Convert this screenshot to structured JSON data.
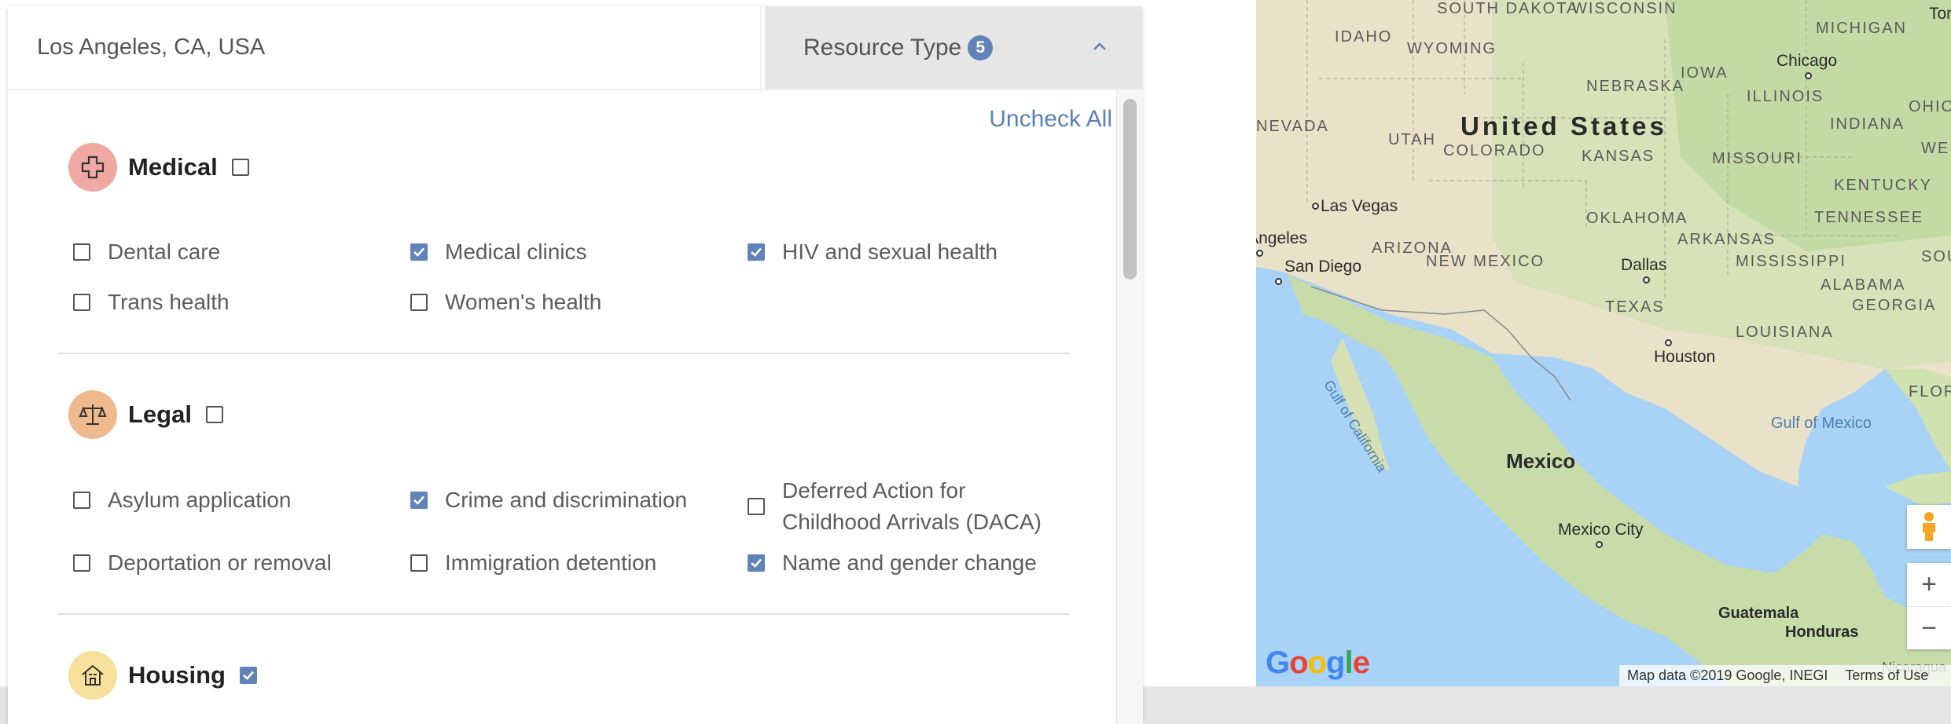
{
  "search": {
    "location": "Los Angeles, CA, USA"
  },
  "filter": {
    "label": "Resource Type",
    "count": "5",
    "uncheck_all": "Uncheck All"
  },
  "categories": [
    {
      "title": "Medical",
      "checked": false,
      "icon": "medical-cross-icon",
      "color": "#f0a8a3",
      "options": [
        {
          "label": "Dental care",
          "checked": false
        },
        {
          "label": "Medical clinics",
          "checked": true
        },
        {
          "label": "HIV and sexual health",
          "checked": true
        },
        {
          "label": "Trans health",
          "checked": false
        },
        {
          "label": "Women's health",
          "checked": false
        }
      ]
    },
    {
      "title": "Legal",
      "checked": false,
      "icon": "scales-icon",
      "color": "#efb98e",
      "options": [
        {
          "label": "Asylum application",
          "checked": false
        },
        {
          "label": "Crime and discrimination",
          "checked": true
        },
        {
          "label": "Deferred Action for Childhood Arrivals (DACA)",
          "checked": false
        },
        {
          "label": "Deportation or removal",
          "checked": false
        },
        {
          "label": "Immigration detention",
          "checked": false
        },
        {
          "label": "Name and gender change",
          "checked": true
        }
      ]
    },
    {
      "title": "Housing",
      "checked": true,
      "icon": "house-icon",
      "color": "#f6e09b",
      "options": []
    }
  ],
  "map": {
    "states": [
      "WISCONSIN",
      "SOUTH DAKOTA",
      "MICHIGAN",
      "IDAHO",
      "WYOMING",
      "IOWA",
      "NEBRASKA",
      "ILLINOIS",
      "INDIANA",
      "OHIO",
      "NEVADA",
      "UTAH",
      "COLORADO",
      "KANSAS",
      "MISSOURI",
      "KENTUCKY",
      "WEST VIRGINIA",
      "OKLAHOMA",
      "TENNESSEE",
      "ARIZONA",
      "NEW MEXICO",
      "ARKANSAS",
      "MISSISSIPPI",
      "ALABAMA",
      "GEORGIA",
      "SOUTH CAROLINA",
      "TEXAS",
      "LOUISIANA",
      "FLORIDA"
    ],
    "cities": [
      "Chicago",
      "Las Vegas",
      "Los Angeles",
      "San Diego",
      "Dallas",
      "Houston",
      "Mexico City",
      "Toronto"
    ],
    "countries": [
      "United States",
      "Mexico",
      "Guatemala",
      "Honduras",
      "Nicaragua"
    ],
    "water": [
      "Gulf of California",
      "Gulf of Mexico"
    ],
    "logo": "Google",
    "attribution": "Map data ©2019 Google, INEGI",
    "terms": "Terms of Use",
    "zoom_in": "+",
    "zoom_out": "−"
  }
}
